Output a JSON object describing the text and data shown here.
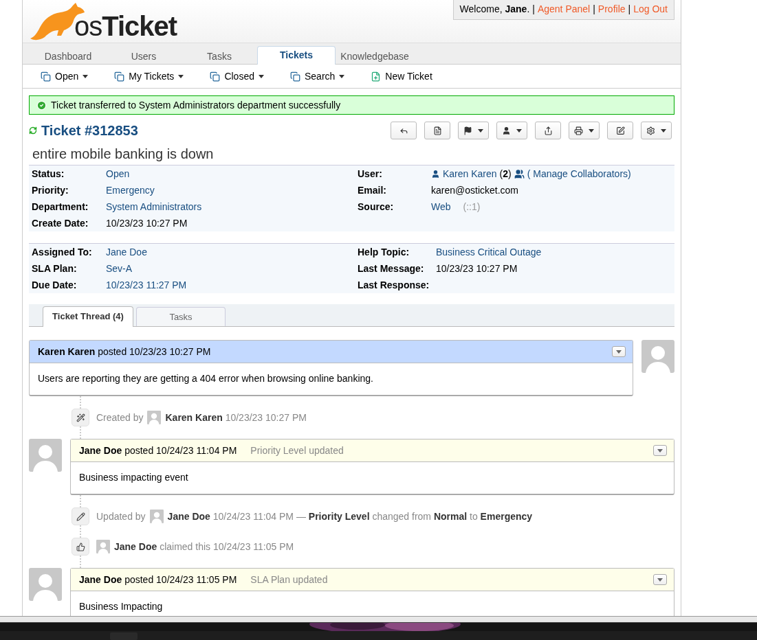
{
  "logo": {
    "text": "os**Ticket**"
  },
  "userbar": {
    "greeting": "Welcome, **Jane**.",
    "separator": "|",
    "links": [
      "Agent Panel",
      "Profile",
      "Log Out"
    ]
  },
  "nav_tabs": [
    {
      "label": "Dashboard",
      "selected": false
    },
    {
      "label": "Users",
      "selected": false
    },
    {
      "label": "Tasks",
      "selected": false
    },
    {
      "label": "Tickets",
      "selected": true
    },
    {
      "label": "Knowledgebase",
      "selected": false
    }
  ],
  "sub_nav": [
    {
      "label": "Open",
      "kind": "menu"
    },
    {
      "label": "My Tickets",
      "kind": "menu"
    },
    {
      "label": "Closed",
      "kind": "menu"
    },
    {
      "label": "Search",
      "kind": "menu"
    },
    {
      "label": "New Ticket",
      "kind": "new"
    }
  ],
  "alert": {
    "text": "Ticket transferred to System Administrators department successfully"
  },
  "ticket": {
    "title": "Ticket #312853",
    "subject": "entire mobile banking is down"
  },
  "actions": [
    {
      "kind": "reply",
      "dropdown": false
    },
    {
      "kind": "file",
      "dropdown": false
    },
    {
      "kind": "flag",
      "dropdown": true
    },
    {
      "kind": "user",
      "dropdown": true
    },
    {
      "kind": "share",
      "dropdown": false
    },
    {
      "kind": "print",
      "dropdown": true
    },
    {
      "kind": "edit",
      "dropdown": false
    },
    {
      "kind": "gear",
      "dropdown": true
    }
  ],
  "info_blocks": [
    {
      "left": [
        {
          "label": "Status:",
          "kind": "link",
          "value": "Open"
        },
        {
          "label": "Priority:",
          "kind": "link",
          "value": "Emergency"
        },
        {
          "label": "Department:",
          "kind": "link",
          "value": "System Administrators"
        },
        {
          "label": "Create Date:",
          "kind": "text",
          "value": "10/23/23 10:27 PM"
        }
      ],
      "right": [
        {
          "label": "User:",
          "kind": "user",
          "value": "Karen Karen",
          "count": "(**2**)",
          "extra": "( Manage Collaborators)"
        },
        {
          "label": "Email:",
          "kind": "text",
          "value": "karen@osticket.com"
        },
        {
          "label": "Source:",
          "kind": "link",
          "value": "Web",
          "note": "(::1)"
        }
      ]
    },
    {
      "left": [
        {
          "label": "Assigned To:",
          "kind": "link",
          "value": "Jane Doe"
        },
        {
          "label": "SLA Plan:",
          "kind": "link",
          "value": "Sev-A"
        },
        {
          "label": "Due Date:",
          "kind": "link",
          "value": "10/23/23 11:27 PM"
        }
      ],
      "right": [
        {
          "label": "Help Topic:",
          "kind": "link",
          "value": "Business Critical Outage"
        },
        {
          "label": "Last Message:",
          "kind": "text",
          "value": "10/23/23 10:27 PM"
        },
        {
          "label": "Last Response:",
          "kind": "text"
        }
      ]
    }
  ],
  "thread_tabs": [
    {
      "label": "Ticket Thread (4)",
      "selected": true
    },
    {
      "label": "Tasks",
      "selected": false
    }
  ],
  "thread": [
    {
      "kind": "message",
      "header": "**Karen Karen** posted 10/23/23 10:27 PM",
      "body": "Users are reporting they are getting a 404 error when browsing online banking."
    },
    {
      "kind": "created",
      "prefix": "Created by",
      "text": "**Karen Karen** 10/23/23 10:27 PM"
    },
    {
      "kind": "response",
      "header": "**Jane Doe** posted 10/24/23 11:04 PM",
      "note": "Priority Level updated",
      "body": "Business impacting event"
    },
    {
      "kind": "updated",
      "prefix": "Updated by",
      "text": "**Jane Doe** 10/24/23 11:04 PM — **Priority Level** changed from **Normal** to **Emergency**"
    },
    {
      "kind": "claimed",
      "text": "**Jane Doe** claimed this 10/24/23 11:05 PM"
    },
    {
      "kind": "response",
      "header": "**Jane Doe** posted 10/24/23 11:05 PM",
      "note": "SLA Plan updated",
      "body": "Business Impacting"
    }
  ]
}
